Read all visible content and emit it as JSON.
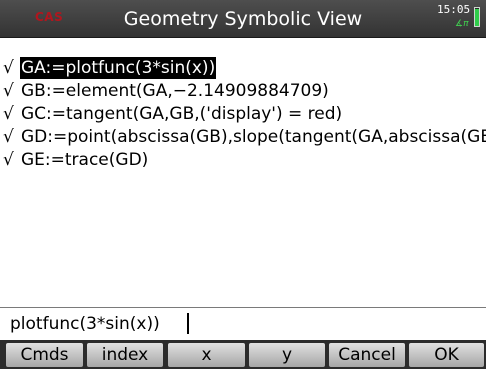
{
  "header": {
    "cas_label": "CAS",
    "title": "Geometry Symbolic View",
    "time": "15:05",
    "angle_mode": "∡π",
    "battery_level": 0.95
  },
  "definitions": [
    {
      "check": "√",
      "text": "GA:=plotfunc(3*sin(x))",
      "selected": true
    },
    {
      "check": "√",
      "text": "GB:=element(GA,−2.14909884709)"
    },
    {
      "check": "√",
      "text": "GC:=tangent(GA,GB,('display') = red)"
    },
    {
      "check": "√",
      "text": "GD:=point(abscissa(GB),slope(tangent(GA,abscissa(GB))))"
    },
    {
      "check": "√",
      "text": "GE:=trace(GD)"
    }
  ],
  "entry_line": "plotfunc(3*sin(x))",
  "menu": {
    "items": [
      "Cmds",
      "index",
      "x",
      "y",
      "Cancel",
      "OK"
    ]
  }
}
